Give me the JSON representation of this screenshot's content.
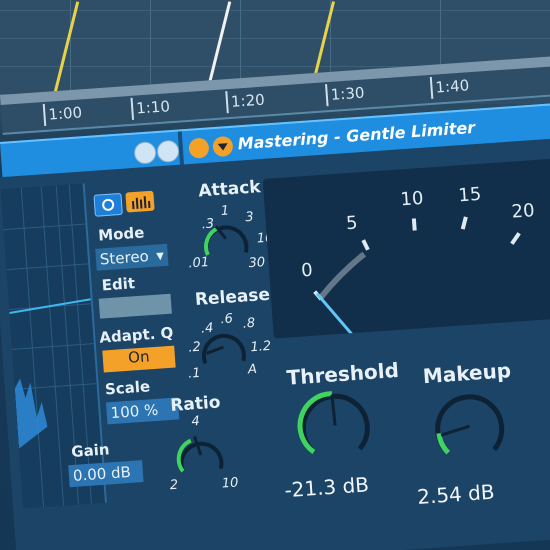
{
  "timeline": {
    "labels": [
      "1:00",
      "1:10",
      "1:20",
      "1:30",
      "1:40"
    ]
  },
  "device": {
    "title": "Mastering - Gentle Limiter",
    "eq": {
      "mode_label": "Mode",
      "mode_value": "Stereo",
      "edit_label": "Edit",
      "adapt_q_label": "Adapt. Q",
      "adapt_q_value": "On",
      "scale_label": "Scale",
      "scale_value": "100 %",
      "gain_label": "Gain",
      "gain_value": "0.00 dB"
    },
    "compressor": {
      "attack_label": "Attack",
      "attack_ticks": [
        ".3",
        "1",
        "3",
        "1",
        "10",
        ".01",
        "30"
      ],
      "release_label": "Release",
      "release_ticks": [
        ".4",
        ".6",
        ".8",
        ".2",
        "1.2",
        ".1",
        "A"
      ],
      "ratio_label": "Ratio",
      "ratio_ticks": [
        "4",
        "2",
        "10"
      ],
      "meter_labels": [
        "0",
        "5",
        "10",
        "15",
        "20"
      ],
      "threshold_label": "Threshold",
      "threshold_value": "-21.3 dB",
      "makeup_label": "Makeup",
      "makeup_value": "2.54 dB"
    }
  }
}
